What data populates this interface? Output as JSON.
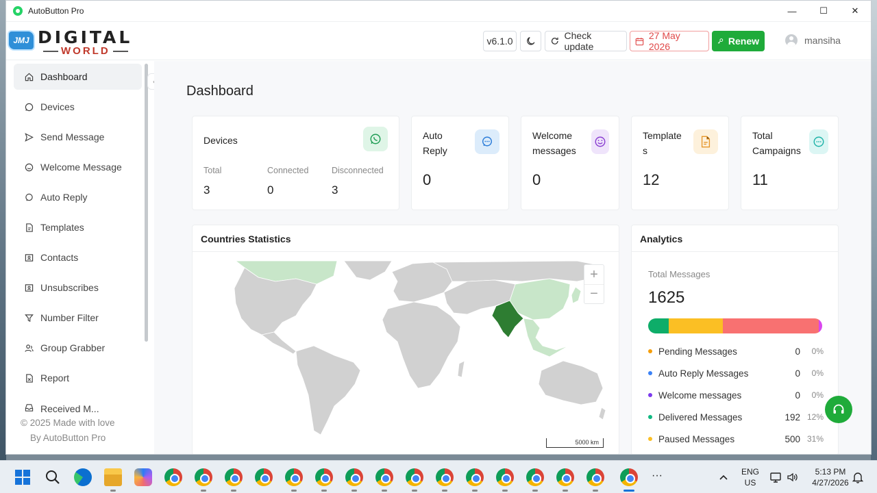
{
  "window": {
    "title": "AutoButton Pro",
    "minimize": "—",
    "maximize": "☐",
    "close": "✕"
  },
  "logo": {
    "badge": "JMJ",
    "line1": "DIGITAL",
    "line2": "WORLD"
  },
  "header": {
    "version": "v6.1.0",
    "check_update": "Check update",
    "expiry_date": "27 May 2026",
    "renew": "Renew",
    "username": "mansiha"
  },
  "sidebar": {
    "items": [
      {
        "label": "Dashboard",
        "icon": "home-icon"
      },
      {
        "label": "Devices",
        "icon": "whatsapp-icon"
      },
      {
        "label": "Send Message",
        "icon": "send-icon"
      },
      {
        "label": "Welcome Message",
        "icon": "smile-icon"
      },
      {
        "label": "Auto Reply",
        "icon": "chat-icon"
      },
      {
        "label": "Templates",
        "icon": "file-icon"
      },
      {
        "label": "Contacts",
        "icon": "contacts-icon"
      },
      {
        "label": "Unsubscribes",
        "icon": "contacts-icon"
      },
      {
        "label": "Number Filter",
        "icon": "filter-icon"
      },
      {
        "label": "Group Grabber",
        "icon": "users-icon"
      },
      {
        "label": "Report",
        "icon": "report-icon"
      },
      {
        "label": "Received M...",
        "icon": "inbox-icon"
      }
    ],
    "footer_line1": "© 2025 Made with love",
    "footer_line2": "By AutoButton Pro"
  },
  "page_title": "Dashboard",
  "stats": {
    "devices": {
      "title": "Devices",
      "total_label": "Total",
      "total": "3",
      "connected_label": "Connected",
      "connected": "0",
      "disconnected_label": "Disconnected",
      "disconnected": "3"
    },
    "auto_reply": {
      "title": "Auto Reply",
      "value": "0"
    },
    "welcome": {
      "title": "Welcome messages",
      "value": "0"
    },
    "templates": {
      "title": "Templates",
      "value": "12"
    },
    "campaigns": {
      "title": "Total Campaigns",
      "value": "11"
    }
  },
  "countries": {
    "title": "Countries Statistics",
    "zoom_in": "+",
    "zoom_out": "−",
    "scale": "5000 km",
    "colors": {
      "highlight": "#2e7d32",
      "light": "#c8e6c9",
      "land": "#d1d1d1"
    }
  },
  "analytics": {
    "title": "Analytics",
    "total_label": "Total Messages",
    "total": "1625",
    "bar": [
      {
        "color": "#0ead69",
        "fraction": 0.12
      },
      {
        "color": "#fbbf24",
        "fraction": 0.31
      },
      {
        "color": "#f87171",
        "fraction": 0.55
      },
      {
        "color": "#d946ef",
        "fraction": 0.02
      }
    ],
    "rows": [
      {
        "name": "Pending Messages",
        "count": "0",
        "pct": "0%",
        "color": "#f59e0b"
      },
      {
        "name": "Auto Reply Messages",
        "count": "0",
        "pct": "0%",
        "color": "#3b82f6"
      },
      {
        "name": "Welcome messages",
        "count": "0",
        "pct": "0%",
        "color": "#7c3aed"
      },
      {
        "name": "Delivered Messages",
        "count": "192",
        "pct": "12%",
        "color": "#10b981"
      },
      {
        "name": "Paused Messages",
        "count": "500",
        "pct": "31%",
        "color": "#fbbf24"
      }
    ]
  },
  "taskbar": {
    "lang": "ENG",
    "region": "US",
    "time": "5:13 PM",
    "date": "4/27/2026",
    "more": "···"
  }
}
